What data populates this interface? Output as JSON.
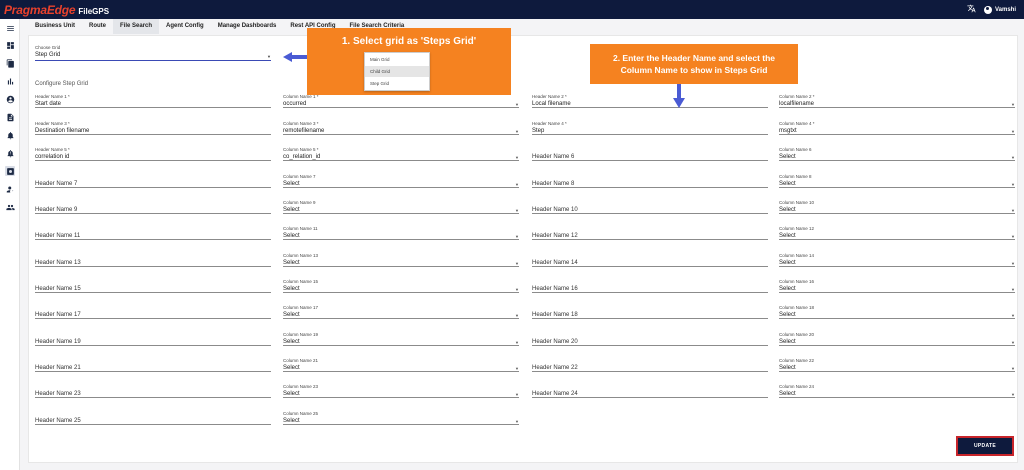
{
  "app": {
    "brand": "PragmaEdge",
    "product": "FileGPS",
    "user": "Vamshi"
  },
  "tabs": [
    {
      "label": "Business Unit"
    },
    {
      "label": "Route"
    },
    {
      "label": "File Search"
    },
    {
      "label": "Agent Config"
    },
    {
      "label": "Manage Dashboards"
    },
    {
      "label": "Rest API Config"
    },
    {
      "label": "File Search Criteria"
    }
  ],
  "choose_grid": {
    "label": "Choose Grid",
    "value": "Step Grid"
  },
  "grid_menu": [
    "Main Grid",
    "Child Grid",
    "Step Grid"
  ],
  "configure_title": "Configure Step Grid",
  "annotations": {
    "step1": "1. Select grid as 'Steps Grid'",
    "step2_line1": "2. Enter the Header Name and select the",
    "step2_line2": "Column Name to show in Steps Grid"
  },
  "fields": {
    "h1": {
      "label": "Header Name 1 *",
      "value": "Start date"
    },
    "c1": {
      "label": "Column Name 1 *",
      "value": "occurred"
    },
    "h2": {
      "label": "Header Name 2 *",
      "value": "Local filename"
    },
    "c2": {
      "label": "Column Name 2 *",
      "value": "localfilename"
    },
    "h3": {
      "label": "Header Name 3 *",
      "value": "Destination filename"
    },
    "c3": {
      "label": "Column Name 3 *",
      "value": "remotefilename"
    },
    "h4": {
      "label": "Header Name 4 *",
      "value": "Step"
    },
    "c4": {
      "label": "Column Name 4 *",
      "value": "msgtxt"
    },
    "h5": {
      "label": "Header Name 5 *",
      "value": "correlation id"
    },
    "c5": {
      "label": "Column Name 5 *",
      "value": "co_relation_id"
    },
    "h6": "Header Name 6",
    "c6": {
      "label": "Column Name 6",
      "value": "Select"
    },
    "h7": "Header Name 7",
    "c7": {
      "label": "Column Name 7",
      "value": "Select"
    },
    "h8": "Header Name 8",
    "c8": {
      "label": "Column Name 8",
      "value": "Select"
    },
    "h9": "Header Name 9",
    "c9": {
      "label": "Column Name 9",
      "value": "Select"
    },
    "h10": "Header Name 10",
    "c10": {
      "label": "Column Name 10",
      "value": "Select"
    },
    "h11": "Header Name 11",
    "c11": {
      "label": "Column Name 11",
      "value": "Select"
    },
    "h12": "Header Name 12",
    "c12": {
      "label": "Column Name 12",
      "value": "Select"
    },
    "h13": "Header Name 13",
    "c13": {
      "label": "Column Name 13",
      "value": "Select"
    },
    "h14": "Header Name 14",
    "c14": {
      "label": "Column Name 14",
      "value": "Select"
    },
    "h15": "Header Name 15",
    "c15": {
      "label": "Column Name 15",
      "value": "Select"
    },
    "h16": "Header Name 16",
    "c16": {
      "label": "Column Name 16",
      "value": "Select"
    },
    "h17": "Header Name 17",
    "c17": {
      "label": "Column Name 17",
      "value": "Select"
    },
    "h18": "Header Name 18",
    "c18": {
      "label": "Column Name 18",
      "value": "Select"
    },
    "h19": "Header Name 19",
    "c19": {
      "label": "Column Name 19",
      "value": "Select"
    },
    "h20": "Header Name 20",
    "c20": {
      "label": "Column Name 20",
      "value": "Select"
    },
    "h21": "Header Name 21",
    "c21": {
      "label": "Column Name 21",
      "value": "Select"
    },
    "h22": "Header Name 22",
    "c22": {
      "label": "Column Name 22",
      "value": "Select"
    },
    "h23": "Header Name 23",
    "c23": {
      "label": "Column Name 23",
      "value": "Select"
    },
    "h24": "Header Name 24",
    "c24": {
      "label": "Column Name 24",
      "value": "Select"
    },
    "h25": "Header Name 25",
    "c25": {
      "label": "Column Name 25",
      "value": "Select"
    }
  },
  "update_label": "UPDATE",
  "colors": {
    "topbar": "#0e1a3d",
    "brand": "#e8412c",
    "annotation": "#f58220",
    "arrow": "#4a5bd4",
    "update_border": "#c8252b"
  }
}
